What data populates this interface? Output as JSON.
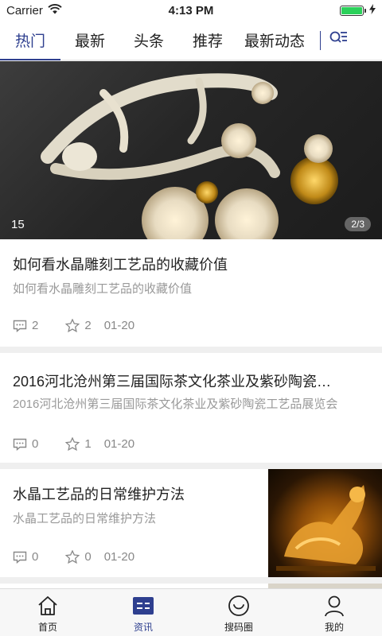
{
  "status_bar": {
    "carrier": "Carrier",
    "time": "4:13 PM"
  },
  "tabs": [
    {
      "label": "热门",
      "active": true
    },
    {
      "label": "最新",
      "active": false
    },
    {
      "label": "头条",
      "active": false
    },
    {
      "label": "推荐",
      "active": false
    },
    {
      "label": "最新动态",
      "active": false
    }
  ],
  "banner": {
    "count": "15",
    "page": "2/3"
  },
  "articles": [
    {
      "title": "如何看水晶雕刻工艺品的收藏价值",
      "summary": "如何看水晶雕刻工艺品的收藏价值",
      "comments": "2",
      "stars": "2",
      "date": "01-20"
    },
    {
      "title": "2016河北沧州第三届国际茶文化茶业及紫砂陶瓷…",
      "summary": "2016河北沧州第三届国际茶文化茶业及紫砂陶瓷工艺品展览会",
      "comments": "0",
      "stars": "1",
      "date": "01-20"
    },
    {
      "title": "水晶工艺品的日常维护方法",
      "summary": "水晶工艺品的日常维护方法",
      "comments": "0",
      "stars": "0",
      "date": "01-20"
    }
  ],
  "bottom_nav": [
    {
      "label": "首页",
      "icon": "home-icon",
      "active": false
    },
    {
      "label": "资讯",
      "icon": "news-icon",
      "active": true
    },
    {
      "label": "搜码圈",
      "icon": "circle-smile-icon",
      "active": false
    },
    {
      "label": "我的",
      "icon": "person-icon",
      "active": false
    }
  ],
  "colors": {
    "accent": "#2e3f8f",
    "battery": "#2bd15a",
    "muted_text": "#999999"
  }
}
